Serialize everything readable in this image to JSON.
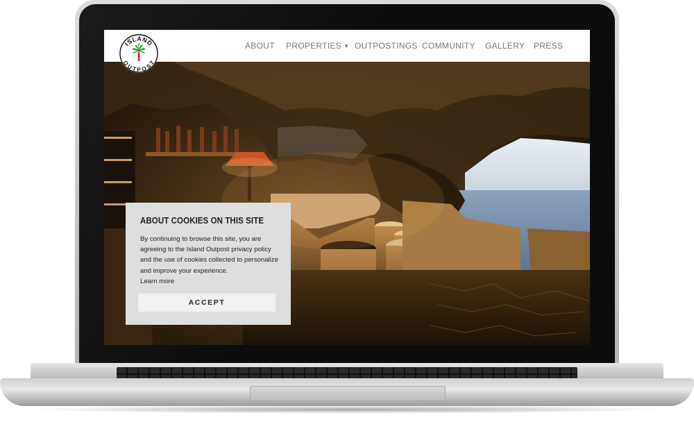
{
  "site": {
    "logo": {
      "top_text": "ISLAND",
      "bottom_text": "OUTPOST",
      "icon": "palm-tree-icon"
    },
    "nav": {
      "items": [
        {
          "label": "ABOUT"
        },
        {
          "label": "PROPERTIES",
          "has_dropdown": true
        },
        {
          "label": "OUTPOSTINGS"
        },
        {
          "label": "COMMUNITY"
        },
        {
          "label": "GALLERY"
        },
        {
          "label": "PRESS"
        }
      ],
      "dropdown_icon": "caret-down-icon"
    },
    "hero": {
      "subject": "cave bar with stone stools overlooking the sea"
    },
    "cookie_notice": {
      "title": "ABOUT COOKIES ON THIS SITE",
      "body": "By continuing to browse this site, you are agreeing to the Island Outpost privacy policy and the use of cookies collected to personalize and improve your experience.",
      "learn_more": "Learn more",
      "accept_label": "ACCEPT"
    }
  },
  "colors": {
    "nav_text": "#777777",
    "cookie_bg": "#dedede",
    "accept_bg": "#f2f2f2",
    "logo_red": "#d8232a",
    "logo_green": "#2f9a3c"
  }
}
